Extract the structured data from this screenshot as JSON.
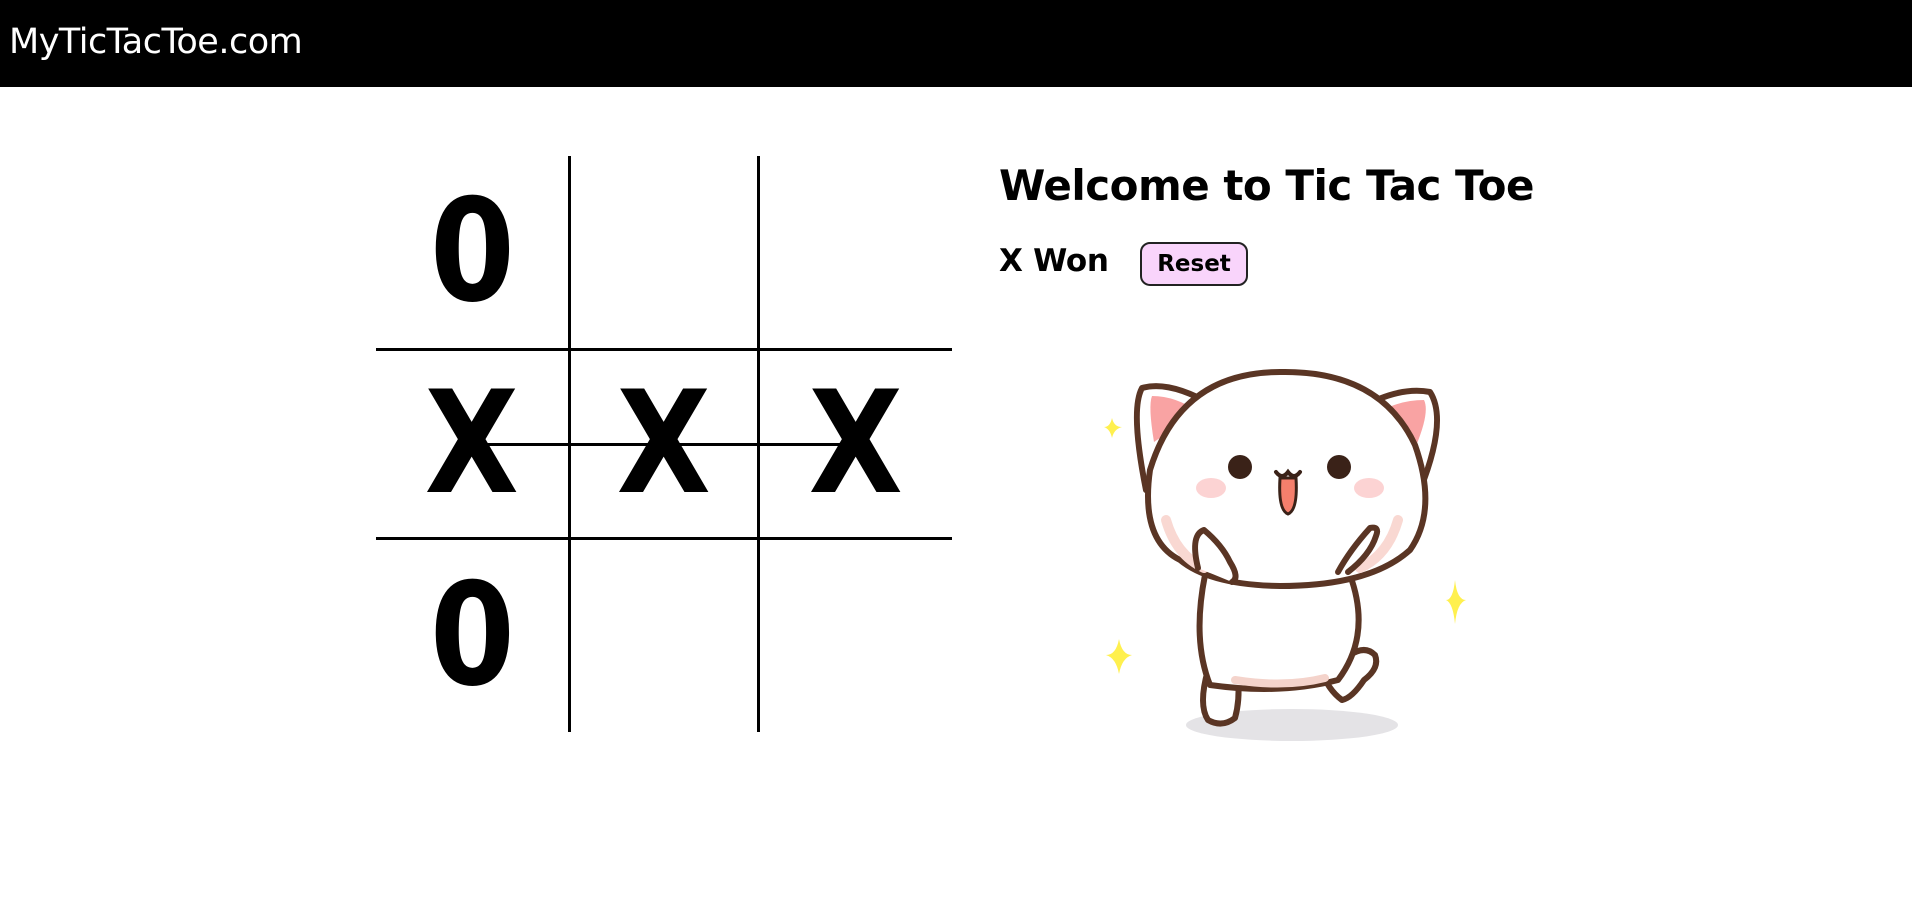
{
  "header": {
    "site_title": "MyTicTacToe.com"
  },
  "board": {
    "cells": [
      "0",
      "",
      "",
      "X",
      "X",
      "X",
      "0",
      "",
      ""
    ]
  },
  "panel": {
    "welcome_title": "Welcome to Tic Tac Toe",
    "status_text": "X Won",
    "reset_label": "Reset"
  },
  "colors": {
    "navbar_bg": "#000000",
    "reset_button_bg": "#f9d4fb",
    "sparkle": "#fff04e"
  },
  "illustration": {
    "icon": "happy-cat-icon"
  }
}
